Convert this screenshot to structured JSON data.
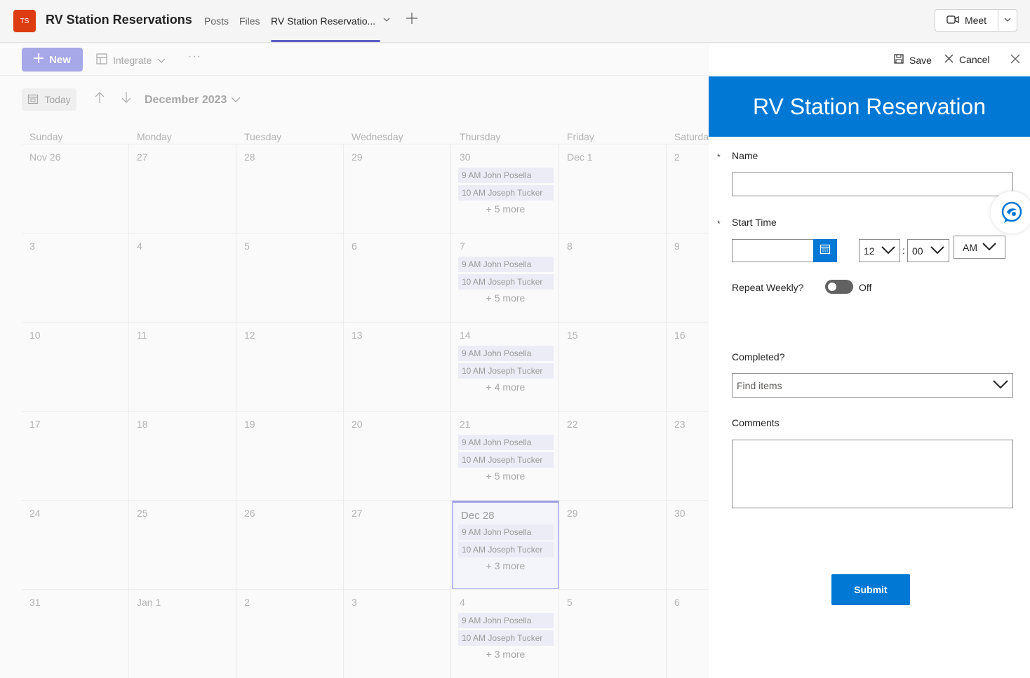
{
  "header": {
    "team_initials": "TS",
    "title": "RV Station Reservations",
    "tabs": [
      {
        "label": "Posts"
      },
      {
        "label": "Files"
      },
      {
        "label": "RV Station Reservatio..."
      }
    ],
    "meet_label": "Meet"
  },
  "commandbar": {
    "new_label": "New",
    "integrate_label": "Integrate",
    "more": "···"
  },
  "calendar": {
    "today_label": "Today",
    "month_label": "December 2023",
    "weekdays": [
      "Sunday",
      "Monday",
      "Tuesday",
      "Wednesday",
      "Thursday",
      "Friday",
      "Saturda"
    ],
    "weeks": [
      {
        "days": [
          "Nov 26",
          "27",
          "28",
          "29",
          "30",
          "Dec 1",
          "2"
        ],
        "more": "+ 5 more"
      },
      {
        "days": [
          "3",
          "4",
          "5",
          "6",
          "7",
          "8",
          "9"
        ],
        "more": "+ 5 more"
      },
      {
        "days": [
          "10",
          "11",
          "12",
          "13",
          "14",
          "15",
          "16"
        ],
        "more": "+ 4 more"
      },
      {
        "days": [
          "17",
          "18",
          "19",
          "20",
          "21",
          "22",
          "23"
        ],
        "more": "+ 5 more"
      },
      {
        "days": [
          "24",
          "25",
          "26",
          "27",
          "Dec 28",
          "29",
          "30"
        ],
        "more": "+ 3 more"
      },
      {
        "days": [
          "31",
          "Jan 1",
          "2",
          "3",
          "4",
          "5",
          "6"
        ],
        "more": "+ 3 more"
      }
    ],
    "event1": "9 AM John Posella",
    "event2": "10 AM Joseph Tucker"
  },
  "panel": {
    "save_label": "Save",
    "cancel_label": "Cancel",
    "banner_title": "RV Station Reservation",
    "required_mark": "*",
    "name_label": "Name",
    "name_value": "",
    "start_time_label": "Start Time",
    "date_value": "",
    "hour_value": "12",
    "colon": ":",
    "minute_value": "00",
    "ampm_value": "AM",
    "repeat_label": "Repeat Weekly?",
    "repeat_state": "Off",
    "completed_label": "Completed?",
    "completed_placeholder": "Find items",
    "comments_label": "Comments",
    "comments_value": "",
    "submit_label": "Submit"
  },
  "colors": {
    "accent": "#5b5fc7",
    "brand_blue": "#0078d4",
    "team_avatar": "#dc3c0f"
  }
}
